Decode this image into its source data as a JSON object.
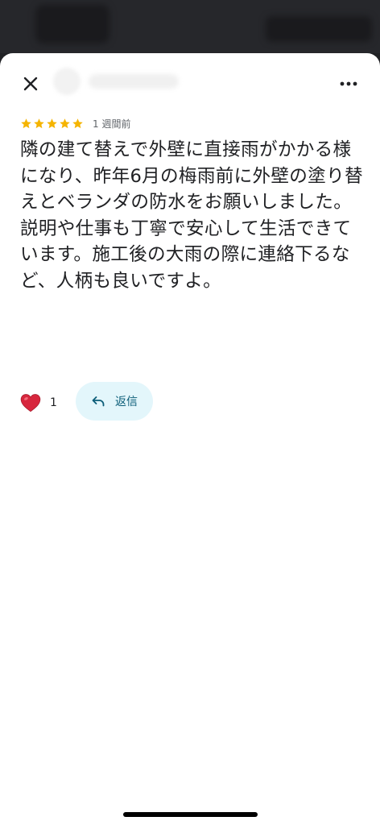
{
  "header": {
    "close_icon": "close-icon",
    "more_icon": "more-vert-icon"
  },
  "review": {
    "rating": 5,
    "max_rating": 5,
    "star_color": "#f5b400",
    "timestamp": "1 週間前",
    "text": "隣の建て替えで外壁に直接雨がかかる様になり、昨年6月の梅雨前に外壁の塗り替えとベランダの防水をお願いしました。説明や仕事も丁寧で安心して生活できています。施工後の大雨の際に連絡下るなど、人柄も良いですよ。"
  },
  "actions": {
    "like_icon": "heart-icon",
    "like_count": "1",
    "reply_icon": "reply-icon",
    "reply_label": "返信",
    "reply_bg": "#e3f6fb"
  }
}
